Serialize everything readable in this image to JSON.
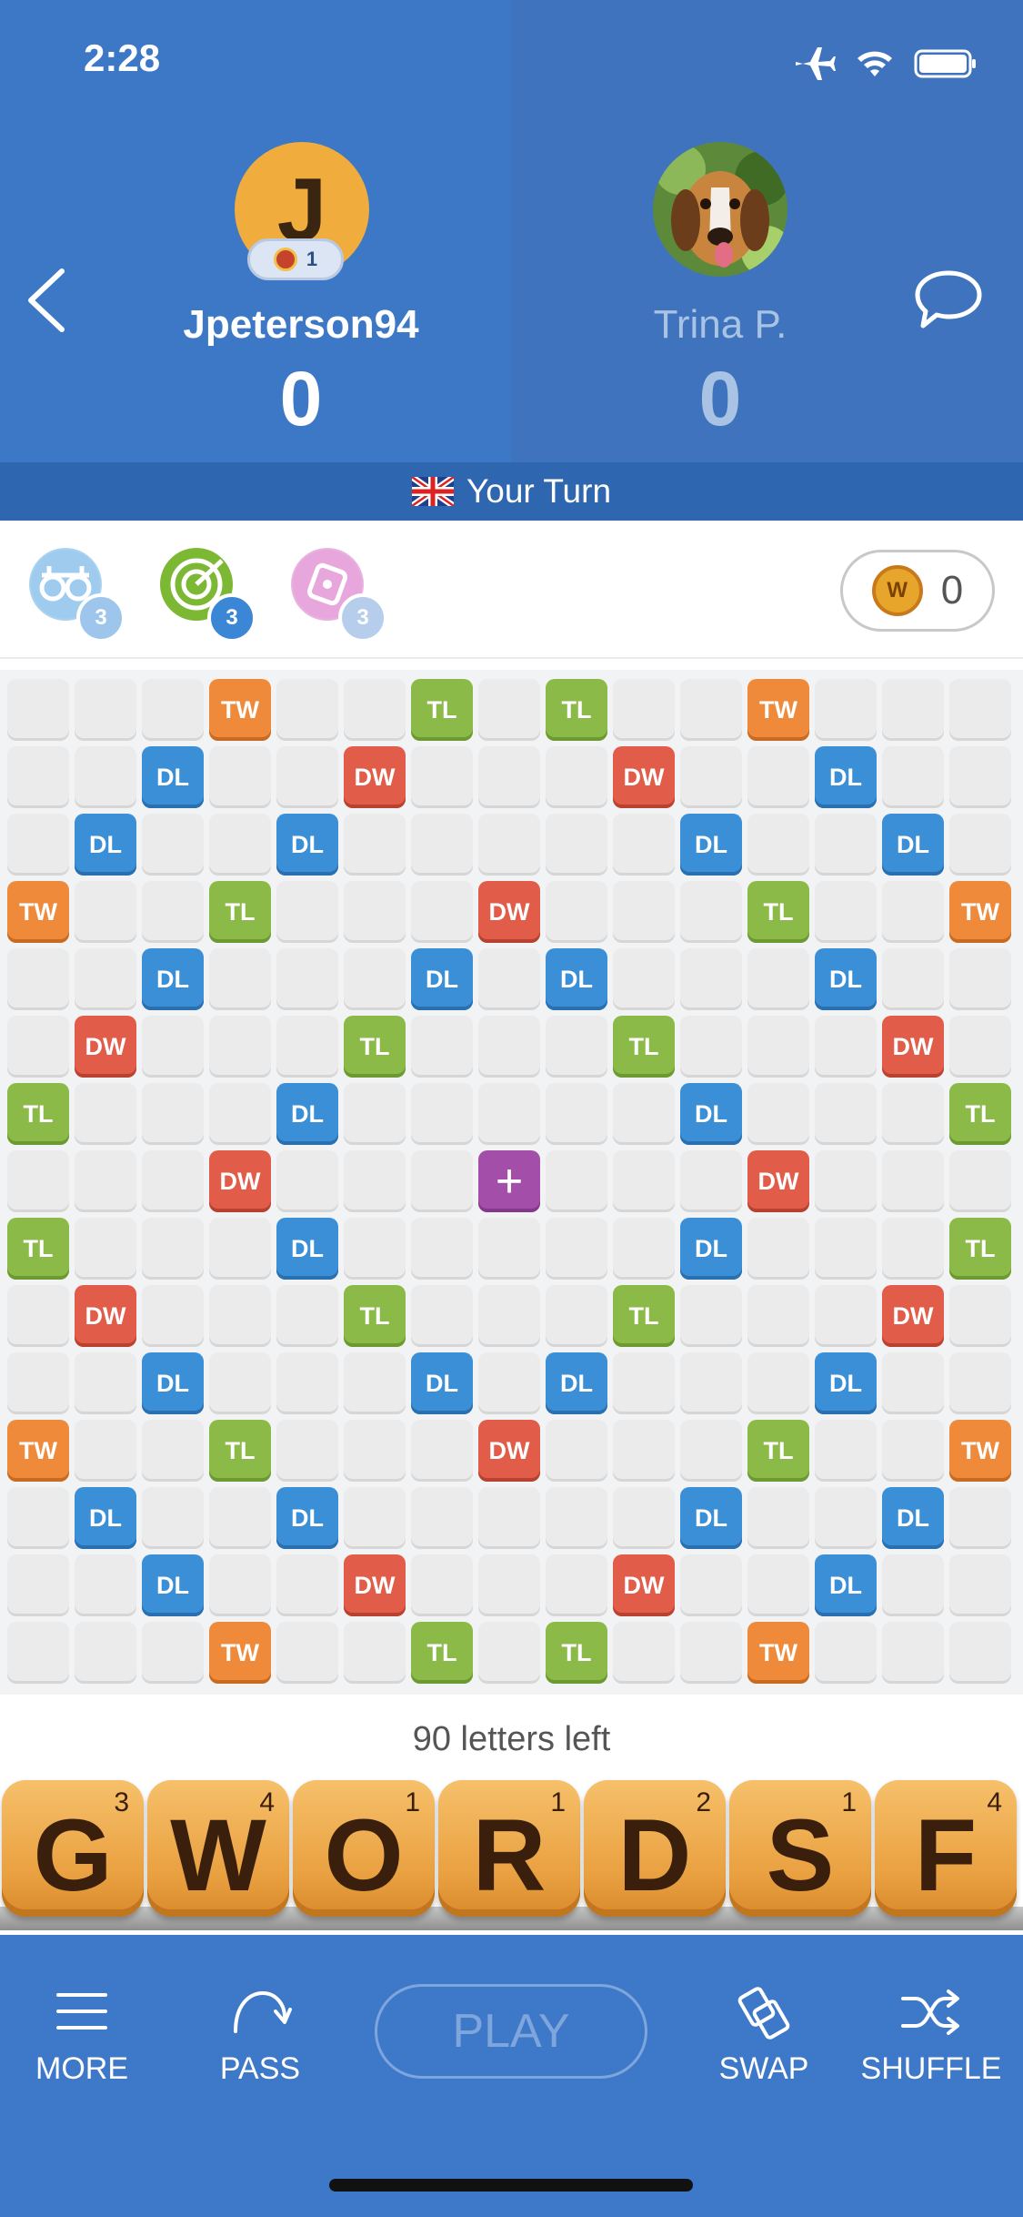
{
  "status_bar": {
    "time": "2:28"
  },
  "players": {
    "me": {
      "initial": "J",
      "name": "Jpeterson94",
      "score": "0",
      "level": "1"
    },
    "opponent": {
      "name": "Trina P.",
      "score": "0"
    }
  },
  "turn": {
    "label": "Your Turn"
  },
  "powerups": [
    {
      "name": "swap-powerup",
      "count": "3",
      "color": "#8fc4ea"
    },
    {
      "name": "hindsight-powerup",
      "count": "3",
      "color": "#7cb834"
    },
    {
      "name": "word-radar-powerup",
      "count": "3",
      "color": "#e4a2d8"
    }
  ],
  "coins": {
    "count": "0"
  },
  "board": {
    "size": 15,
    "premium_labels": {
      "tw": "TW",
      "dw": "DW",
      "tl": "TL",
      "dl": "DL",
      "center": "+"
    },
    "rows": [
      [
        "",
        "",
        "",
        "tw",
        "",
        "",
        "tl",
        "",
        "tl",
        "",
        "",
        "tw",
        "",
        "",
        ""
      ],
      [
        "",
        "",
        "dl",
        "",
        "",
        "dw",
        "",
        "",
        "",
        "dw",
        "",
        "",
        "dl",
        "",
        ""
      ],
      [
        "",
        "dl",
        "",
        "",
        "dl",
        "",
        "",
        "",
        "",
        "",
        "dl",
        "",
        "",
        "dl",
        ""
      ],
      [
        "tw",
        "",
        "",
        "tl",
        "",
        "",
        "",
        "dw",
        "",
        "",
        "",
        "tl",
        "",
        "",
        "tw"
      ],
      [
        "",
        "",
        "dl",
        "",
        "",
        "",
        "dl",
        "",
        "dl",
        "",
        "",
        "",
        "dl",
        "",
        ""
      ],
      [
        "",
        "dw",
        "",
        "",
        "",
        "tl",
        "",
        "",
        "",
        "tl",
        "",
        "",
        "",
        "dw",
        ""
      ],
      [
        "tl",
        "",
        "",
        "",
        "dl",
        "",
        "",
        "",
        "",
        "",
        "dl",
        "",
        "",
        "",
        "tl"
      ],
      [
        "",
        "",
        "",
        "dw",
        "",
        "",
        "",
        "center",
        "",
        "",
        "",
        "dw",
        "",
        "",
        ""
      ],
      [
        "tl",
        "",
        "",
        "",
        "dl",
        "",
        "",
        "",
        "",
        "",
        "dl",
        "",
        "",
        "",
        "tl"
      ],
      [
        "",
        "dw",
        "",
        "",
        "",
        "tl",
        "",
        "",
        "",
        "tl",
        "",
        "",
        "",
        "dw",
        ""
      ],
      [
        "",
        "",
        "dl",
        "",
        "",
        "",
        "dl",
        "",
        "dl",
        "",
        "",
        "",
        "dl",
        "",
        ""
      ],
      [
        "tw",
        "",
        "",
        "tl",
        "",
        "",
        "",
        "dw",
        "",
        "",
        "",
        "tl",
        "",
        "",
        "tw"
      ],
      [
        "",
        "dl",
        "",
        "",
        "dl",
        "",
        "",
        "",
        "",
        "",
        "dl",
        "",
        "",
        "dl",
        ""
      ],
      [
        "",
        "",
        "dl",
        "",
        "",
        "dw",
        "",
        "",
        "",
        "dw",
        "",
        "",
        "dl",
        "",
        ""
      ],
      [
        "",
        "",
        "",
        "tw",
        "",
        "",
        "tl",
        "",
        "tl",
        "",
        "",
        "tw",
        "",
        "",
        ""
      ]
    ]
  },
  "letters_left": "90 letters left",
  "rack": [
    {
      "letter": "G",
      "points": "3"
    },
    {
      "letter": "W",
      "points": "4"
    },
    {
      "letter": "O",
      "points": "1"
    },
    {
      "letter": "R",
      "points": "1"
    },
    {
      "letter": "D",
      "points": "2"
    },
    {
      "letter": "S",
      "points": "1"
    },
    {
      "letter": "F",
      "points": "4"
    }
  ],
  "bottom_bar": {
    "more": "MORE",
    "pass": "PASS",
    "play": "PLAY",
    "swap": "SWAP",
    "shuffle": "SHUFFLE"
  }
}
